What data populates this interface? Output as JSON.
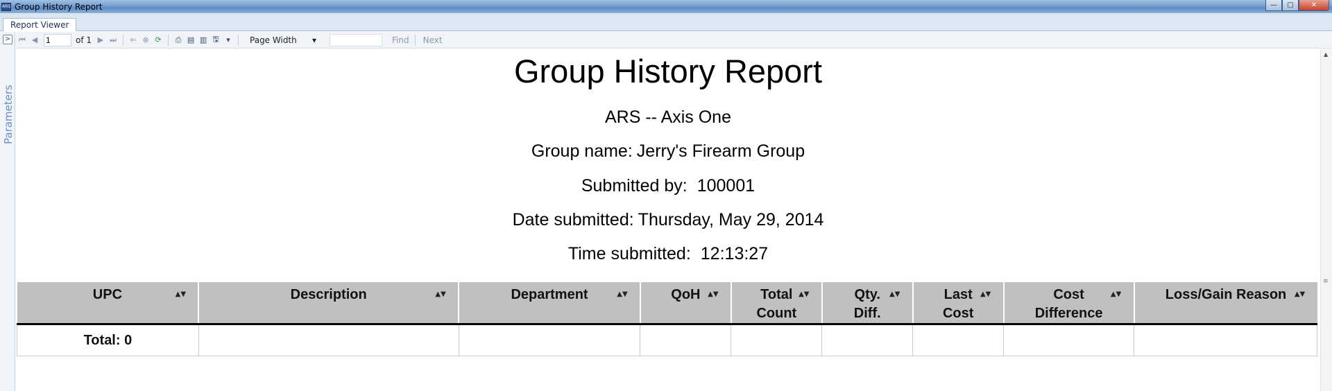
{
  "window": {
    "title": "Group History Report",
    "app_icon_text": "ARS",
    "buttons": {
      "minimize": "—",
      "maximize": "□",
      "close": "✕"
    }
  },
  "tabs": [
    {
      "label": "Report Viewer"
    }
  ],
  "params_rail": {
    "label": "Parameters",
    "toggle": ">"
  },
  "toolbar": {
    "page_input": "1",
    "of_label": "of 1",
    "zoom": "Page Width",
    "find_label": "Find",
    "next_label": "Next",
    "icons": {
      "first": "first-page-icon",
      "prev": "previous-page-icon",
      "next": "next-page-icon",
      "last": "last-page-icon",
      "back": "back-icon",
      "stop": "stop-icon",
      "refresh": "refresh-icon",
      "print": "print-icon",
      "print_layout": "print-layout-icon",
      "page_setup": "page-setup-icon",
      "export": "export-icon"
    }
  },
  "report": {
    "title": "Group History Report",
    "company": "ARS -- Axis One",
    "group_label": "Group name:",
    "group_value": "Jerry's Firearm Group",
    "submitted_by_label": "Submitted by:",
    "submitted_by_value": "100001",
    "date_label": "Date submitted:",
    "date_value": "Thursday, May 29, 2014",
    "time_label": "Time submitted:",
    "time_value": "12:13:27"
  },
  "table": {
    "columns": [
      "UPC",
      "Description",
      "Department",
      "QoH",
      "Total Count",
      "Qty. Diff.",
      "Last Cost",
      "Cost Difference",
      "Loss/Gain Reason"
    ],
    "total_row": [
      "Total: 0",
      "",
      "",
      "",
      "",
      "",
      "",
      "",
      ""
    ]
  }
}
